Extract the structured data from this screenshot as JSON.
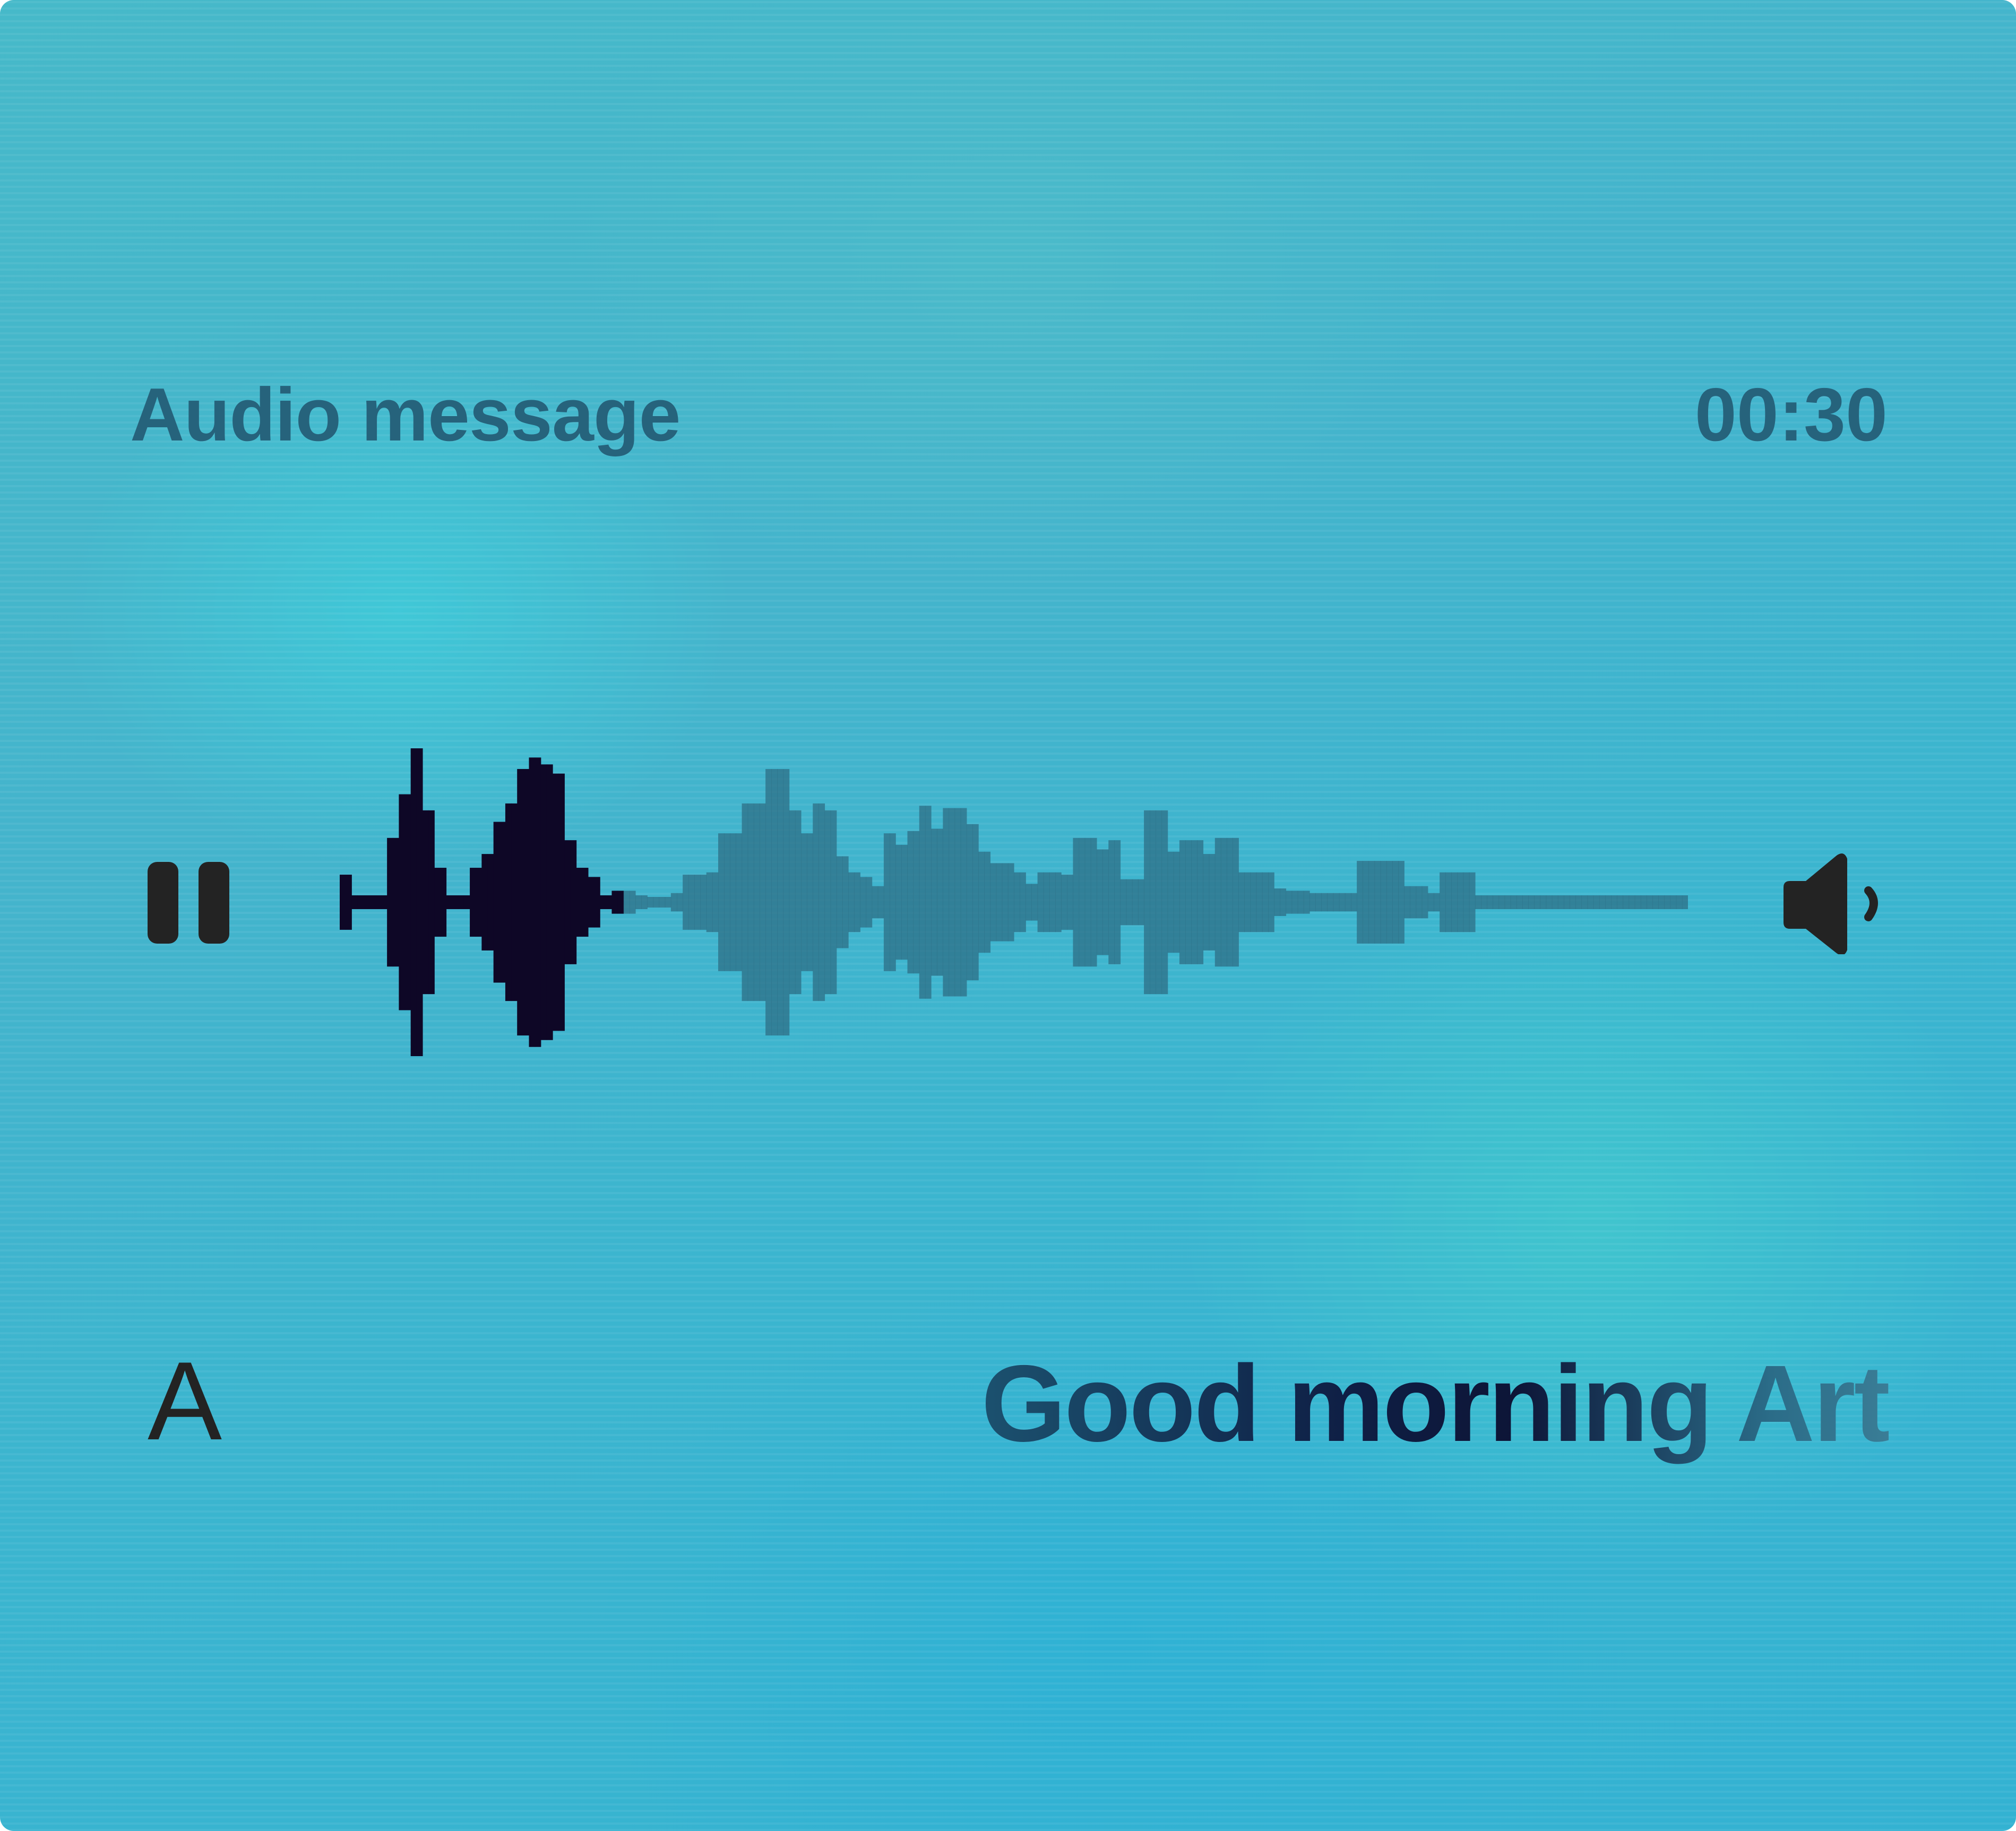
{
  "player": {
    "title": "Audio message",
    "duration": "00:30",
    "transcript": "Good morning Art",
    "font_toggle_label": "A"
  },
  "controls": {
    "play_pause_icon": "pause-icon",
    "volume_icon": "speaker-icon"
  },
  "progress": 0.21,
  "waveform": {
    "bars": [
      12,
      12,
      3,
      3,
      3,
      3,
      3,
      3,
      28,
      28,
      47,
      47,
      67,
      67,
      40,
      40,
      15,
      15,
      3,
      3,
      3,
      3,
      15,
      15,
      21,
      21,
      35,
      35,
      43,
      43,
      58,
      58,
      63,
      63,
      60,
      60,
      56,
      56,
      27,
      27,
      15,
      15,
      11,
      11,
      3,
      3,
      5,
      5,
      5,
      5,
      3,
      3,
      2,
      2,
      1,
      1,
      4,
      4,
      12,
      12,
      12,
      12,
      13,
      13,
      30,
      30,
      30,
      30,
      43,
      43,
      43,
      43,
      58,
      58,
      58,
      58,
      40,
      40,
      30,
      30,
      43,
      43,
      40,
      40,
      20,
      20,
      13,
      13,
      11,
      11,
      7,
      7,
      30,
      30,
      25,
      25,
      31,
      31,
      42,
      42,
      32,
      32,
      41,
      41,
      41,
      41,
      34,
      34,
      22,
      22,
      17,
      17,
      17,
      17,
      13,
      13,
      8,
      8,
      13,
      13,
      13,
      13,
      12,
      12,
      28,
      28,
      28,
      28,
      23,
      23,
      27,
      27,
      10,
      10,
      10,
      10,
      40,
      40,
      40,
      40,
      22,
      22,
      27,
      27,
      27,
      27,
      21,
      21,
      28,
      28,
      28,
      28,
      13,
      13,
      13,
      13,
      13,
      13,
      6,
      6,
      5,
      5,
      5,
      5,
      4,
      4,
      4,
      4,
      4,
      4,
      4,
      4,
      18,
      18,
      18,
      18,
      18,
      18,
      18,
      18,
      7,
      7,
      7,
      7,
      4,
      4,
      13,
      13,
      13,
      13,
      13,
      13,
      3,
      3,
      3,
      3,
      3,
      3,
      3,
      3,
      3,
      3,
      3,
      3,
      3,
      3,
      3,
      3,
      3,
      3,
      3,
      3,
      3,
      3,
      3,
      3,
      3,
      3,
      3,
      3,
      3,
      3,
      3,
      3,
      3,
      3,
      3,
      3
    ],
    "played_color": "#0e0726",
    "unplayed_color": "#2e6f86"
  }
}
